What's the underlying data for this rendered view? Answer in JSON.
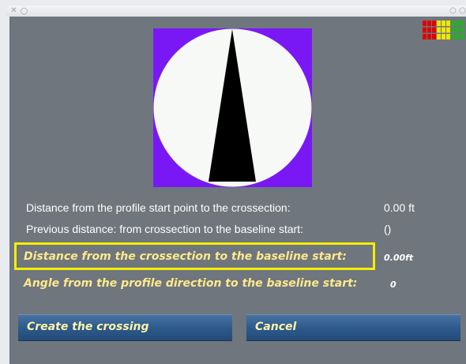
{
  "titlebar": {
    "close_glyph": "✕",
    "dot_glyph": "○"
  },
  "compass": {
    "background_color": "#7a18f5",
    "dial_color": "#f7f9f7",
    "needle_color": "#000000",
    "heading_degrees": 0
  },
  "signal_meter": {
    "icon": "signal-level-meter-icon",
    "colors": [
      "#e00000",
      "#f2e600",
      "#2eaa2e"
    ]
  },
  "fields": {
    "profile_distance_label": "Distance from the profile start point to the crossection:",
    "profile_distance_value": "0.00 ft",
    "previous_distance_label": "Previous distance: from crossection to the baseline start:",
    "previous_distance_value": "()",
    "baseline_distance_label": "Distance from the crossection to the baseline start:",
    "baseline_distance_value": "0.00ft",
    "angle_label": "Angle from the profile direction to the baseline start:",
    "angle_value": "0"
  },
  "buttons": {
    "create_label": "Create the crossing",
    "cancel_label": "Cancel"
  }
}
